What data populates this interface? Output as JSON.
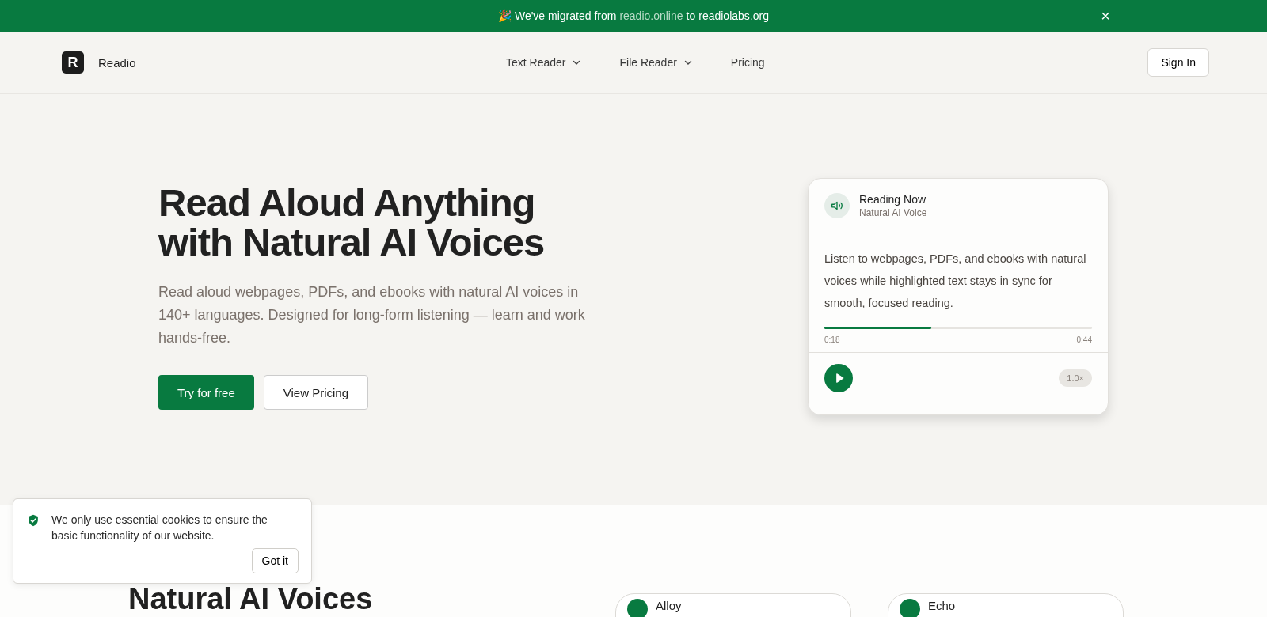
{
  "announcement": {
    "emoji": "🎉",
    "text_before": "We've migrated from",
    "old_domain": "readio.online",
    "text_middle": "to",
    "new_domain": "readiolabs.org",
    "close": "×"
  },
  "nav": {
    "logo_letter": "R",
    "brand": "Readio",
    "links": [
      {
        "label": "Text Reader",
        "dropdown": true
      },
      {
        "label": "File Reader",
        "dropdown": true
      },
      {
        "label": "Pricing",
        "dropdown": false
      }
    ],
    "sign_in": "Sign In"
  },
  "hero": {
    "title_lines": [
      "Read Aloud Anything",
      "with Natural AI Voices"
    ],
    "subtitle": "Read aloud webpages, PDFs, and ebooks with natural AI voices in 140+ languages. Designed for long-form listening — learn and work hands-free.",
    "primary_button": "Try for free",
    "secondary_button": "View Pricing"
  },
  "player": {
    "title": "Reading Now",
    "subtitle": "Natural AI Voice",
    "text": "Listen to webpages, PDFs, and ebooks with natural voices while highlighted text stays in sync for smooth, focused reading.",
    "level": 0.4,
    "elapsed": "0:18",
    "total": "0:44",
    "speed": "1.0×"
  },
  "voices": {
    "heading": "Natural AI Voices",
    "cards": [
      {
        "name": "Alloy"
      },
      {
        "name": "Echo"
      }
    ]
  },
  "cookie": {
    "text": "We only use essential cookies to ensure the basic functionality of our website.",
    "button": "Got it"
  }
}
